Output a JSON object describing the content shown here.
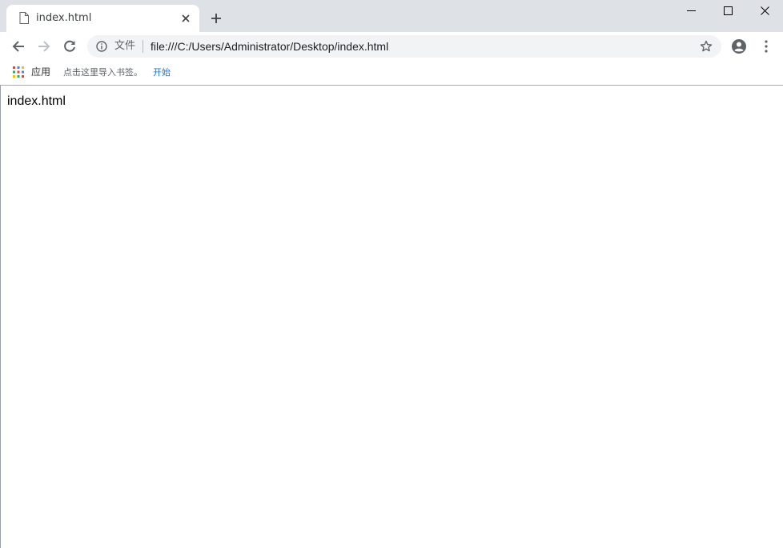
{
  "browser": {
    "tab": {
      "title": "index.html",
      "favicon": "document-icon"
    },
    "window_controls": [
      "minimize-icon",
      "maximize-icon",
      "close-icon"
    ],
    "toolbar": {
      "back_icon": "arrow-left-icon",
      "forward_icon": "arrow-right-icon",
      "reload_icon": "reload-icon",
      "security_icon": "info-icon",
      "security_chip": "文件",
      "url": "file:///C:/Users/Administrator/Desktop/index.html",
      "bookmark_icon": "star-icon",
      "profile_icon": "account-circle-icon",
      "menu_icon": "more-vertical-icon"
    },
    "bookmarks_bar": {
      "apps_label": "应用",
      "hint_text": "点击这里导入书签。",
      "start_link": "开始"
    }
  },
  "page": {
    "body_text": "index.html"
  },
  "colors": {
    "tabstrip_bg": "#dee1e6",
    "omnibox_bg": "#f1f3f4",
    "link": "#1a73e8",
    "icon": "#5f6368"
  }
}
